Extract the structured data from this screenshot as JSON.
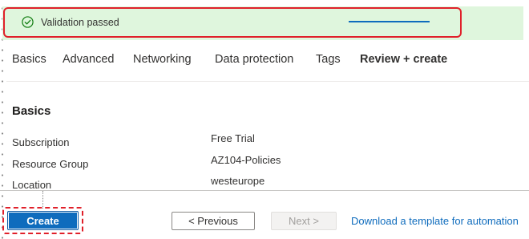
{
  "banner": {
    "text": "Validation passed",
    "icon": "check-circle-icon",
    "status_color": "#107c10",
    "background_color": "#dff6dd"
  },
  "tabs": [
    {
      "label": "Basics",
      "active": false
    },
    {
      "label": "Advanced",
      "active": false
    },
    {
      "label": "Networking",
      "active": false
    },
    {
      "label": "Data protection",
      "active": false
    },
    {
      "label": "Tags",
      "active": false
    },
    {
      "label": "Review + create",
      "active": true
    }
  ],
  "section": {
    "title": "Basics",
    "rows": [
      {
        "label": "Subscription",
        "value": "Free Trial"
      },
      {
        "label": "Resource Group",
        "value": "AZ104-Policies"
      },
      {
        "label": "Location",
        "value": "westeurope"
      }
    ]
  },
  "footer": {
    "create_label": "Create",
    "previous_label": "< Previous",
    "next_label": "Next >",
    "download_link": "Download a template for automation"
  },
  "colors": {
    "accent": "#0f6cbd",
    "highlight": "#e0202a"
  }
}
